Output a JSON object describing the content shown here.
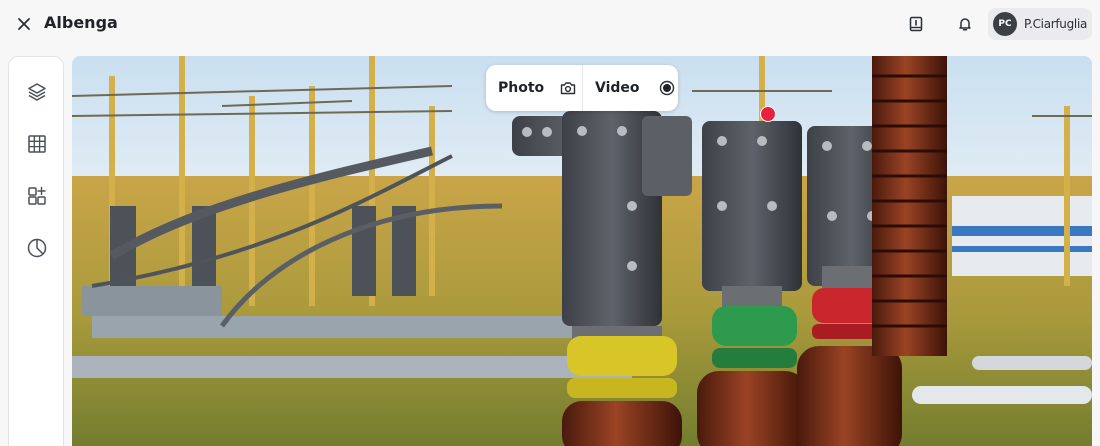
{
  "header": {
    "title": "Albenga",
    "close_icon": "close-icon",
    "icons": [
      "clipboard-alert-icon",
      "bell-icon"
    ],
    "user": {
      "initials": "PC",
      "name": "P.Ciarfuglia"
    }
  },
  "sidebar": {
    "items": [
      {
        "icon": "layers-icon"
      },
      {
        "icon": "table-icon"
      },
      {
        "icon": "widgets-add-icon"
      },
      {
        "icon": "pie-chart-icon"
      }
    ]
  },
  "capture": {
    "photo_label": "Photo",
    "photo_icon": "camera-icon",
    "video_label": "Video",
    "video_icon": "record-icon"
  },
  "marker": {
    "color": "#e8213f"
  },
  "colors": {
    "accent": "#e8213f",
    "background": "#f7f7f8"
  }
}
